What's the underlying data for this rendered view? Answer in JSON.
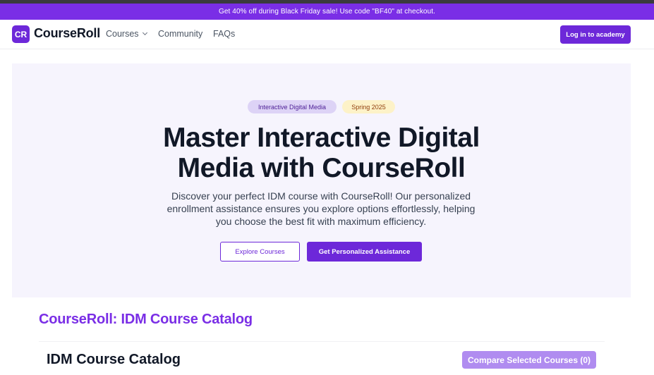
{
  "promo": {
    "text": "Get 40% off during Black Friday sale! Use code \"BF40\" at checkout."
  },
  "header": {
    "logo_badge": "CR",
    "logo_text": "CourseRoll",
    "nav": {
      "courses": "Courses",
      "community": "Community",
      "faqs": "FAQs"
    },
    "login_label": "Log in to academy"
  },
  "hero": {
    "badge_subject": "Interactive Digital Media",
    "badge_term": "Spring 2025",
    "title_line1": "Master Interactive Digital",
    "title_line2": "Media with CourseRoll",
    "subtitle": "Discover your perfect IDM course with CourseRoll! Our personalized enrollment assistance ensures you explore options effortlessly, helping you choose the best fit with maximum efficiency.",
    "explore_label": "Explore Courses",
    "assist_label": "Get Personalized Assistance"
  },
  "catalog": {
    "section_heading": "CourseRoll: IDM Course Catalog",
    "title": "IDM Course Catalog",
    "compare_label": "Compare Selected Courses (0)"
  },
  "colors": {
    "brand": "#6d28d9",
    "promo": "#7a2ee6",
    "hero_bg": "#f6f4fd"
  }
}
